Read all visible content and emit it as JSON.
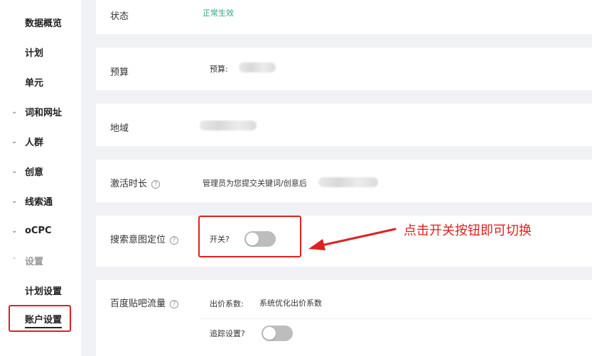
{
  "sidebar": {
    "items": [
      {
        "label": "数据概览",
        "chevron": ""
      },
      {
        "label": "计划",
        "chevron": ""
      },
      {
        "label": "单元",
        "chevron": ""
      },
      {
        "label": "词和网址",
        "chevron": "⌄"
      },
      {
        "label": "人群",
        "chevron": "⌄"
      },
      {
        "label": "创意",
        "chevron": "⌄"
      },
      {
        "label": "线索通",
        "chevron": "⌄"
      },
      {
        "label": "oCPC",
        "chevron": "⌄"
      },
      {
        "label": "设置",
        "chevron": "⌃"
      },
      {
        "label": "计划设置",
        "chevron": ""
      },
      {
        "label": "账户设置",
        "chevron": ""
      }
    ]
  },
  "rows": {
    "status": {
      "title": "状态",
      "value": "正常生效"
    },
    "budget": {
      "title": "预算",
      "prefix": "预算:"
    },
    "region": {
      "title": "地域"
    },
    "activation": {
      "title": "激活时长",
      "text": "管理员为您提交关键词/创意后"
    },
    "intent": {
      "title": "搜索意图定位",
      "switch_label": "开关",
      "switch_on": false
    },
    "tieba": {
      "title": "百度贴吧流量",
      "bid_label": "出价系数:",
      "bid_value": "系统优化出价系数",
      "track_label": "追踪设置",
      "track_on": false
    }
  },
  "annotation": {
    "text": "点击开关按钮即可切换",
    "color": "#e02020"
  },
  "colors": {
    "status_green": "#2aa876",
    "highlight_red": "#e02020",
    "toggle_off": "#bdbdbd"
  }
}
